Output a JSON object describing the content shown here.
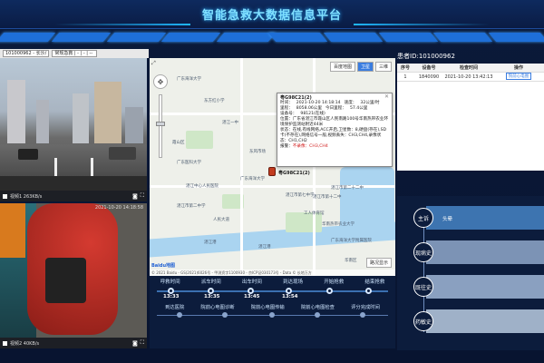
{
  "app": {
    "title": "智能急救大数据信息平台"
  },
  "video": {
    "device_select": "101000962 - 长沙/",
    "channel_select": "常规急救 | - | - | --",
    "stream1_label": "视频1 263KB/s",
    "stream2_label": "视频2 40KB/s",
    "timestamp2": "2021-10-20 14:18:58"
  },
  "map": {
    "tab_map": "百度地图",
    "tab_satellite": "卫星",
    "tab_hybrid": "三维",
    "traffic_btn": "路况显示",
    "logo": "Baidu地图",
    "copyright": "© 2021 Baidu - GS(2021)6026号 - 甲测资字1100930 - 京ICP证030173号 - Data © 长地万方",
    "vehicle_label": "粤G98C21(2)",
    "info": {
      "title": "粤G98C21(2)",
      "time_label": "时间：",
      "time": "2021-10-20 14:18:14",
      "speed_label": "速度：",
      "speed": "32公里/时",
      "mileage_label": "里程：",
      "mileage": "8058.06公里",
      "today_label": "今日里程：",
      "today": "57.4公里",
      "device_label": "设备号：",
      "device": "98121(在线)",
      "location_label": "位置：",
      "location": "广东省湛江市霞山区人民南路100号华南热带农业环境保护监测站附近44米",
      "status_label": "状态：",
      "status": "在线,有线网络,ACC开启,卫星数：8,硬盘(存在),SD卡(不存在),网络信号一般,视频丢失：CH3,CH4,录像状态：CH1,CH2",
      "alarm_label": "报警：",
      "alarm": "不录像：CH3,CH4"
    },
    "pois": [
      "广东海洋大学",
      "东方红小学",
      "霞山区",
      "湛江一中",
      "广东医科大学",
      "广东海洋大学",
      "湛江市第十二中",
      "湛江市第二中学",
      "人民大道",
      "东风市场",
      "工人体育馆",
      "湛江港",
      "华南热带农业大学",
      "湛江市第二十二中",
      "湛江中心人民医院",
      "湛江市第七中学",
      "广东海洋大学附属医院",
      "湛江港",
      "华南区"
    ]
  },
  "timeline": {
    "stages": [
      {
        "label": "呼救时间",
        "time": "13:33"
      },
      {
        "label": "派车时间",
        "time": "13:35"
      },
      {
        "label": "出车时间",
        "time": "13:45"
      },
      {
        "label": "到达现场",
        "time": "13:54"
      },
      {
        "label": "开始抢救",
        "time": ""
      },
      {
        "label": "结束抢救",
        "time": ""
      }
    ],
    "stages2": [
      "到达医院",
      "院前心电图诊断",
      "院前心电图传输",
      "院前心电图检查",
      "评分完成时间"
    ]
  },
  "patient": {
    "id_label": "患者ID:",
    "id": "101000962"
  },
  "exam_table": {
    "headers": [
      "序号",
      "设备号",
      "检查时间",
      "操作"
    ],
    "rows": [
      {
        "index": "1",
        "device": "1840090",
        "time": "2021-10-20 13:42:13",
        "action": "院前心电图"
      }
    ]
  },
  "history": {
    "items": [
      {
        "label": "主诉",
        "text": "头晕"
      },
      {
        "label": "现病史",
        "text": ""
      },
      {
        "label": "既往史",
        "text": ""
      },
      {
        "label": "药敏史",
        "text": ""
      }
    ]
  }
}
